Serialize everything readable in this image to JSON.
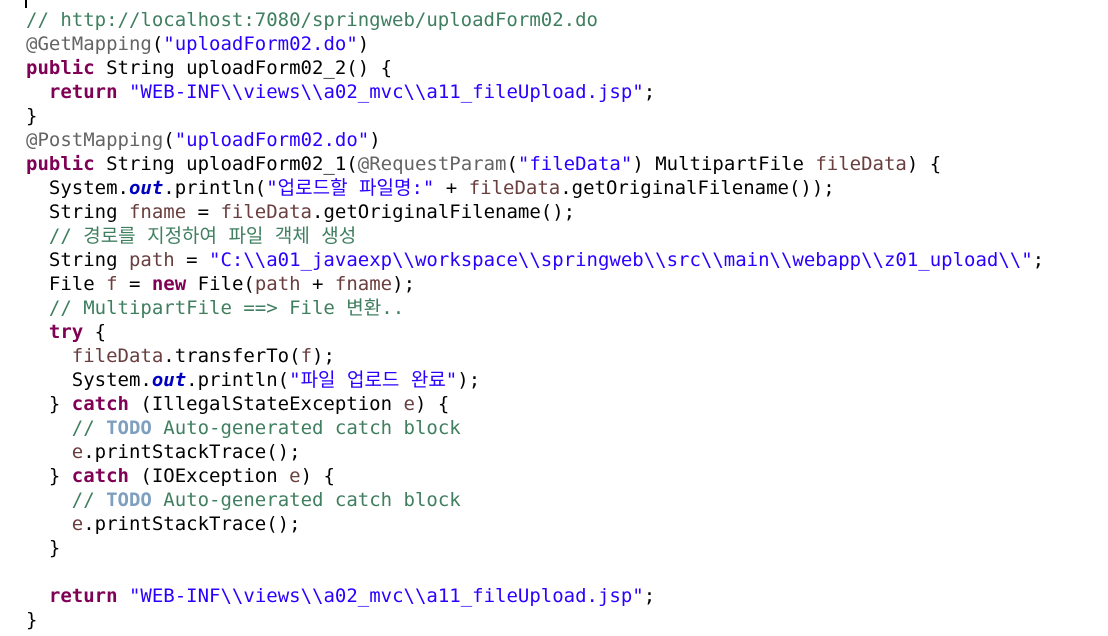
{
  "editor": {
    "colors": {
      "keyword": "#7f0055",
      "string": "#2a00ff",
      "comment": "#3f7f5f",
      "annotation": "#646464",
      "static_field": "#0000c0",
      "local_variable": "#6a3e3e",
      "todo_tag": "#7f9fbf",
      "plain": "#000000"
    },
    "lines": [
      [
        [
          "cmt",
          "// http://localhost:7080/springweb/uploadForm02.do"
        ]
      ],
      [
        [
          "ann",
          "@GetMapping"
        ],
        [
          "plain",
          "("
        ],
        [
          "str",
          "\"uploadForm02.do\""
        ],
        [
          "plain",
          ")"
        ]
      ],
      [
        [
          "kw",
          "public"
        ],
        [
          "plain",
          " String uploadForm02_2() {"
        ]
      ],
      [
        [
          "plain",
          "  "
        ],
        [
          "kw",
          "return"
        ],
        [
          "plain",
          " "
        ],
        [
          "str",
          "\"WEB-INF\\\\views\\\\a02_mvc\\\\a11_fileUpload.jsp\""
        ],
        [
          "plain",
          ";"
        ]
      ],
      [
        [
          "plain",
          "}"
        ]
      ],
      [
        [
          "ann",
          "@PostMapping"
        ],
        [
          "plain",
          "("
        ],
        [
          "str",
          "\"uploadForm02.do\""
        ],
        [
          "plain",
          ")"
        ]
      ],
      [
        [
          "kw",
          "public"
        ],
        [
          "plain",
          " String uploadForm02_1("
        ],
        [
          "ann",
          "@RequestParam"
        ],
        [
          "plain",
          "("
        ],
        [
          "str",
          "\"fileData\""
        ],
        [
          "plain",
          ") MultipartFile "
        ],
        [
          "var",
          "fileData"
        ],
        [
          "plain",
          ") {"
        ]
      ],
      [
        [
          "plain",
          "  System."
        ],
        [
          "fld",
          "out"
        ],
        [
          "plain",
          ".println("
        ],
        [
          "str",
          "\"업로드할 파일명:\""
        ],
        [
          "plain",
          " + "
        ],
        [
          "var",
          "fileData"
        ],
        [
          "plain",
          ".getOriginalFilename());"
        ]
      ],
      [
        [
          "plain",
          "  String "
        ],
        [
          "var",
          "fname"
        ],
        [
          "plain",
          " = "
        ],
        [
          "var",
          "fileData"
        ],
        [
          "plain",
          ".getOriginalFilename();"
        ]
      ],
      [
        [
          "plain",
          "  "
        ],
        [
          "cmt",
          "// 경로를 지정하여 파일 객체 생성"
        ]
      ],
      [
        [
          "plain",
          "  String "
        ],
        [
          "var",
          "path"
        ],
        [
          "plain",
          " = "
        ],
        [
          "str",
          "\"C:\\\\a01_javaexp\\\\workspace\\\\springweb\\\\src\\\\main\\\\webapp\\\\z01_upload\\\\\""
        ],
        [
          "plain",
          ";"
        ]
      ],
      [
        [
          "plain",
          "  File "
        ],
        [
          "var",
          "f"
        ],
        [
          "plain",
          " = "
        ],
        [
          "kw",
          "new"
        ],
        [
          "plain",
          " File("
        ],
        [
          "var",
          "path"
        ],
        [
          "plain",
          " + "
        ],
        [
          "var",
          "fname"
        ],
        [
          "plain",
          ");"
        ]
      ],
      [
        [
          "plain",
          "  "
        ],
        [
          "cmt",
          "// MultipartFile ==> File 변환.."
        ]
      ],
      [
        [
          "plain",
          "  "
        ],
        [
          "kw",
          "try"
        ],
        [
          "plain",
          " {"
        ]
      ],
      [
        [
          "plain",
          "    "
        ],
        [
          "var",
          "fileData"
        ],
        [
          "plain",
          ".transferTo("
        ],
        [
          "var",
          "f"
        ],
        [
          "plain",
          ");"
        ]
      ],
      [
        [
          "plain",
          "    System."
        ],
        [
          "fld",
          "out"
        ],
        [
          "plain",
          ".println("
        ],
        [
          "str",
          "\"파일 업로드 완료\""
        ],
        [
          "plain",
          ");"
        ]
      ],
      [
        [
          "plain",
          "  } "
        ],
        [
          "kw",
          "catch"
        ],
        [
          "plain",
          " (IllegalStateException "
        ],
        [
          "var",
          "e"
        ],
        [
          "plain",
          ") {"
        ]
      ],
      [
        [
          "plain",
          "    "
        ],
        [
          "cmt",
          "// "
        ],
        [
          "todo",
          "TODO"
        ],
        [
          "cmt",
          " Auto-generated catch block"
        ]
      ],
      [
        [
          "plain",
          "    "
        ],
        [
          "var",
          "e"
        ],
        [
          "plain",
          ".printStackTrace();"
        ]
      ],
      [
        [
          "plain",
          "  } "
        ],
        [
          "kw",
          "catch"
        ],
        [
          "plain",
          " (IOException "
        ],
        [
          "var",
          "e"
        ],
        [
          "plain",
          ") {"
        ]
      ],
      [
        [
          "plain",
          "    "
        ],
        [
          "cmt",
          "// "
        ],
        [
          "todo",
          "TODO"
        ],
        [
          "cmt",
          " Auto-generated catch block"
        ]
      ],
      [
        [
          "plain",
          "    "
        ],
        [
          "var",
          "e"
        ],
        [
          "plain",
          ".printStackTrace();"
        ]
      ],
      [
        [
          "plain",
          "  }"
        ]
      ],
      [
        [
          "plain",
          ""
        ]
      ],
      [
        [
          "plain",
          "  "
        ],
        [
          "kw",
          "return"
        ],
        [
          "plain",
          " "
        ],
        [
          "str",
          "\"WEB-INF\\\\views\\\\a02_mvc\\\\a11_fileUpload.jsp\""
        ],
        [
          "plain",
          ";"
        ]
      ],
      [
        [
          "plain",
          "}"
        ]
      ]
    ]
  }
}
